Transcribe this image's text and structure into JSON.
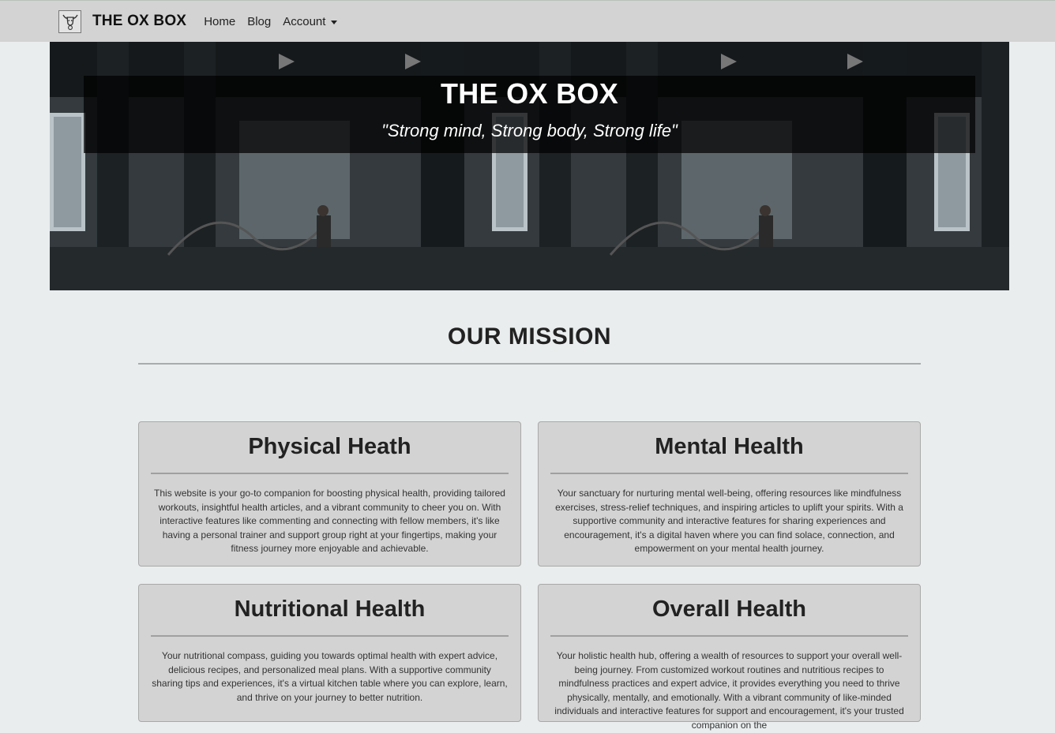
{
  "navbar": {
    "brand": "THE OX BOX",
    "logo_icon": "ox-logo-icon",
    "links": [
      "Home",
      "Blog"
    ],
    "account_label": "Account"
  },
  "hero": {
    "title": "THE OX BOX",
    "tagline": "\"Strong mind, Strong body, Strong life\""
  },
  "mission": {
    "title": "OUR MISSION",
    "cards": [
      {
        "title": "Physical Heath",
        "text": "This website is your go-to companion for boosting physical health, providing tailored workouts, insightful health articles, and a vibrant community to cheer you on. With interactive features like commenting and connecting with fellow members, it's like having a personal trainer and support group right at your fingertips, making your fitness journey more enjoyable and achievable."
      },
      {
        "title": "Mental Health",
        "text": "Your sanctuary for nurturing mental well-being, offering resources like mindfulness exercises, stress-relief techniques, and inspiring articles to uplift your spirits. With a supportive community and interactive features for sharing experiences and encouragement, it's a digital haven where you can find solace, connection, and empowerment on your mental health journey."
      },
      {
        "title": "Nutritional Health",
        "text": "Your nutritional compass, guiding you towards optimal health with expert advice, delicious recipes, and personalized meal plans. With a supportive community sharing tips and experiences, it's a virtual kitchen table where you can explore, learn, and thrive on your journey to better nutrition."
      },
      {
        "title": "Overall Health",
        "text": "Your holistic health hub, offering a wealth of resources to support your overall well-being journey. From customized workout routines and nutritious recipes to mindfulness practices and expert advice, it provides everything you need to thrive physically, mentally, and emotionally. With a vibrant community of like-minded individuals and interactive features for support and encouragement, it's your trusted companion on the"
      }
    ]
  },
  "colors": {
    "page_bg": "#e9edee",
    "navbar_bg": "#d3d3d3",
    "card_bg": "#d3d3d3"
  }
}
